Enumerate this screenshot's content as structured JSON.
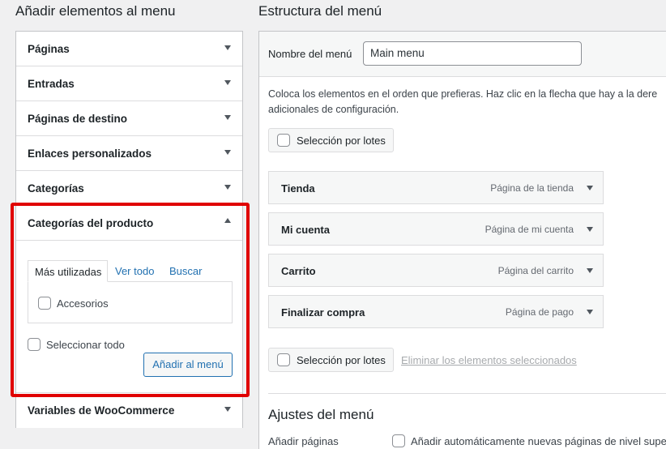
{
  "left": {
    "title": "Añadir elementos al menu",
    "sections": [
      {
        "label": "Páginas"
      },
      {
        "label": "Entradas"
      },
      {
        "label": "Páginas de destino"
      },
      {
        "label": "Enlaces personalizados"
      },
      {
        "label": "Categorías"
      },
      {
        "label": "Categorías del producto"
      },
      {
        "label": "Variables de WooCommerce"
      }
    ],
    "product_categories": {
      "tabs": {
        "most_used": "Más utilizadas",
        "view_all": "Ver todo",
        "search": "Buscar"
      },
      "items": [
        {
          "label": "Accesorios",
          "checked": false
        }
      ],
      "select_all": "Seleccionar todo",
      "add_button": "Añadir al menú"
    }
  },
  "right": {
    "title": "Estructura del menú",
    "menu_name_label": "Nombre del menú",
    "menu_name_value": "Main menu",
    "instructions_line1": "Coloca los elementos en el orden que prefieras. Haz clic en la flecha que hay a la dere",
    "instructions_line2": "adicionales de configuración.",
    "bulk_select": "Selección por lotes",
    "menu_items": [
      {
        "title": "Tienda",
        "type": "Página de la tienda"
      },
      {
        "title": "Mi cuenta",
        "type": "Página de mi cuenta"
      },
      {
        "title": "Carrito",
        "type": "Página del carrito"
      },
      {
        "title": "Finalizar compra",
        "type": "Página de pago"
      }
    ],
    "bulk_select_bottom": "Selección por lotes",
    "delete_selected": "Eliminar los elementos seleccionados",
    "settings": {
      "title": "Ajustes del menú",
      "add_pages_label": "Añadir páginas",
      "add_pages_option": "Añadir automáticamente nuevas páginas de nivel super"
    }
  },
  "colors": {
    "highlight": "#e00000",
    "link": "#2271b1"
  }
}
